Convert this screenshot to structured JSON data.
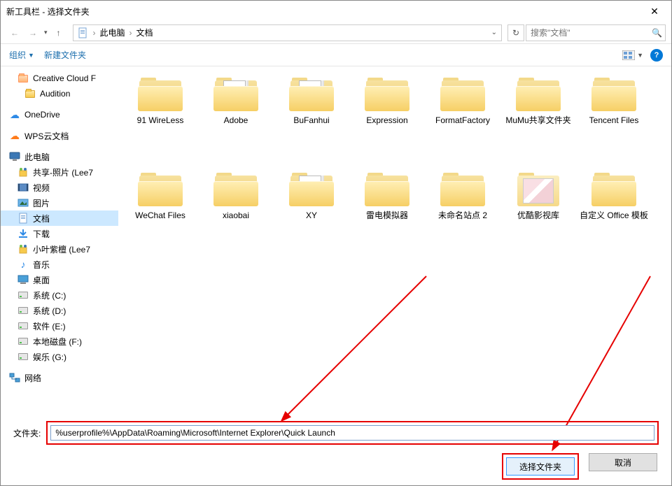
{
  "window": {
    "title": "新工具栏 - 选择文件夹"
  },
  "navbar": {
    "crumb_root": "此电脑",
    "crumb_current": "文档",
    "search_placeholder": "搜索\"文档\""
  },
  "toolbar": {
    "organize": "组织",
    "new_folder": "新建文件夹"
  },
  "sidebar": {
    "items": [
      {
        "label": "Creative Cloud F",
        "icon": "cc"
      },
      {
        "label": "Audition",
        "icon": "folder"
      },
      {
        "label": "OneDrive",
        "icon": "onedrive"
      },
      {
        "label": "WPS云文档",
        "icon": "wps"
      },
      {
        "label": "此电脑",
        "icon": "pc"
      },
      {
        "label": "共享-照片 (Lee7",
        "icon": "share"
      },
      {
        "label": "视频",
        "icon": "video"
      },
      {
        "label": "图片",
        "icon": "pictures"
      },
      {
        "label": "文档",
        "icon": "doc",
        "selected": true
      },
      {
        "label": "下载",
        "icon": "download"
      },
      {
        "label": "小叶紫檀 (Lee7",
        "icon": "share"
      },
      {
        "label": "音乐",
        "icon": "music"
      },
      {
        "label": "桌面",
        "icon": "desktop"
      },
      {
        "label": "系统 (C:)",
        "icon": "drive"
      },
      {
        "label": "系统 (D:)",
        "icon": "drive"
      },
      {
        "label": "软件 (E:)",
        "icon": "drive"
      },
      {
        "label": "本地磁盘 (F:)",
        "icon": "drive"
      },
      {
        "label": "娱乐 (G:)",
        "icon": "drive"
      },
      {
        "label": "网络",
        "icon": "network"
      }
    ]
  },
  "folders": {
    "row1": [
      {
        "label": "91 WireLess",
        "type": "plain"
      },
      {
        "label": "Adobe",
        "type": "doc"
      },
      {
        "label": "BuFanhui",
        "type": "doc"
      },
      {
        "label": "Expression",
        "type": "plain"
      },
      {
        "label": "FormatFactory",
        "type": "plain"
      },
      {
        "label": "MuMu共享文件夹",
        "type": "plain"
      },
      {
        "label": "Tencent Files",
        "type": "plain"
      }
    ],
    "row2": [
      {
        "label": "WeChat Files",
        "type": "plain"
      },
      {
        "label": "xiaobai",
        "type": "plain"
      },
      {
        "label": "XY",
        "type": "doc"
      },
      {
        "label": "雷电模拟器",
        "type": "plain"
      },
      {
        "label": "未命名站点 2",
        "type": "plain"
      },
      {
        "label": "优酷影视库",
        "type": "thumb"
      },
      {
        "label": "自定义 Office 模板",
        "type": "plain"
      }
    ]
  },
  "footer": {
    "path_label": "文件夹:",
    "path_value": "%userprofile%\\AppData\\Roaming\\Microsoft\\Internet Explorer\\Quick Launch",
    "select_btn": "选择文件夹",
    "cancel_btn": "取消"
  }
}
